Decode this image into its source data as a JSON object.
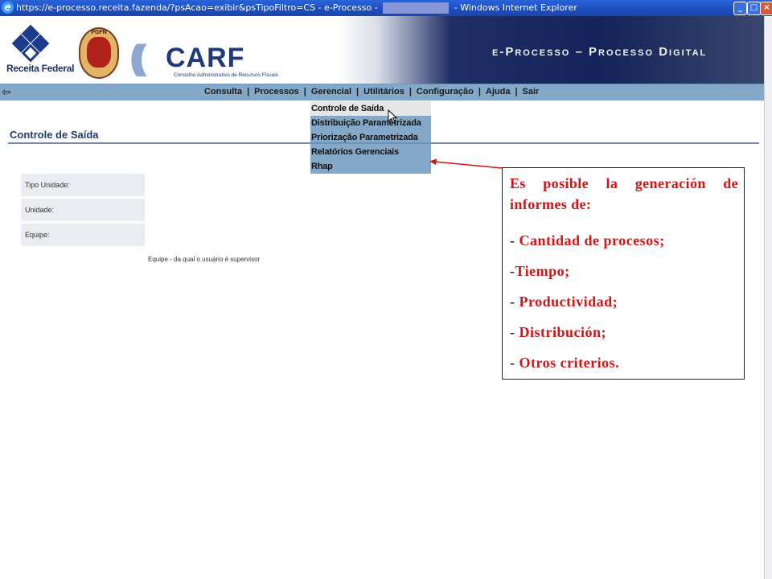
{
  "window": {
    "title_prefix": "https://e-processo.receita.fazenda/?psAcao=exibir&psTipoFiltro=CS - e-Processo -",
    "title_suffix": "- Windows Internet Explorer",
    "icon": "ie-icon",
    "buttons": [
      "minimize",
      "maximize",
      "close"
    ]
  },
  "header": {
    "receita_label": "Receita Federal",
    "pgfn_label": "PGFN",
    "carf_word": "CARF",
    "carf_sub": "Conselho Administrativo de Recursos Fiscais",
    "eprocesso_title": "e-Processo – Processo Digital"
  },
  "nav": {
    "items": [
      "Consulta",
      "Processos",
      "Gerencial",
      "Utilitários",
      "Configuração",
      "Ajuda",
      "Sair"
    ]
  },
  "dropdown": {
    "items": [
      "Controle de Saída",
      "Distribuição Parametrizada",
      "Priorização Parametrizada",
      "Relatórios Gerenciais",
      "Rhap"
    ],
    "hovered_index": 0
  },
  "page": {
    "title": "Controle de Saída",
    "fields": [
      "Tipo Unidade:",
      "Unidade:",
      "Equipe:"
    ],
    "hint": "Equipe - da qual o usuário é supervisor"
  },
  "annotation": {
    "intro": "Es posible la generación de informes de:",
    "items": [
      "Cantidad de procesos;",
      "Tiempo;",
      "Productividad;",
      "Distribución;",
      "Otros criterios."
    ],
    "color": "#d21414"
  },
  "colors": {
    "nav_bg": "#84a8c8",
    "title_bar": "#1d4fc0",
    "heading": "#1d3d6e"
  }
}
